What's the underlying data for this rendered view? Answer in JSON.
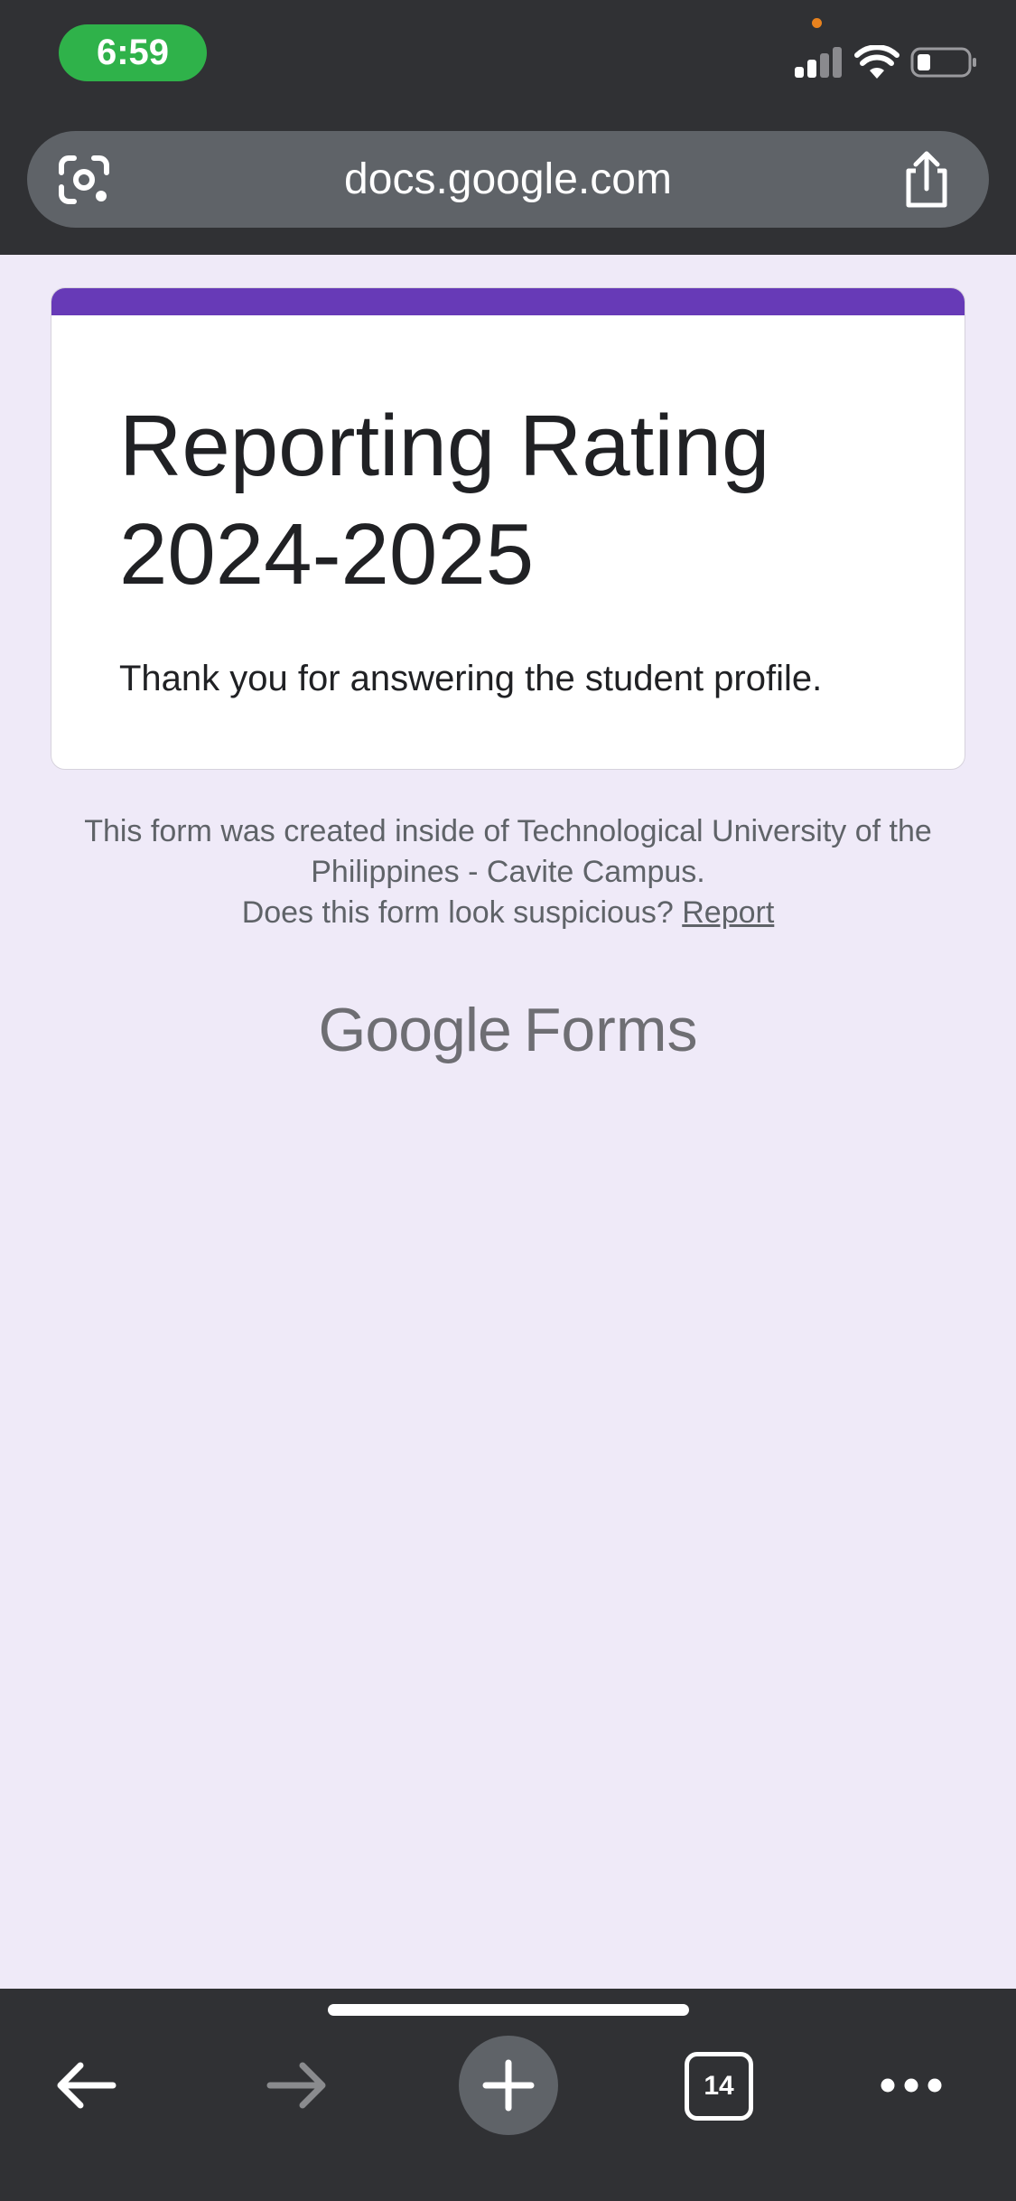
{
  "status_bar": {
    "time": "6:59"
  },
  "browser": {
    "url": "docs.google.com",
    "tab_count": "14"
  },
  "form": {
    "title": "Reporting Rating 2024-2025",
    "message": "Thank you for answering the student profile.",
    "accent_color": "#673ab7"
  },
  "footer": {
    "org_line": "This form was created inside of Technological University of the Philippines - Cavite Campus.",
    "suspicious_text": "Does this form look suspicious?",
    "report_label": "Report",
    "logo_google": "Google",
    "logo_forms": "Forms"
  },
  "icons": {
    "lens": "google-lens-icon",
    "share": "share-icon",
    "back": "back-arrow-icon",
    "forward": "forward-arrow-icon",
    "new_tab": "plus-icon",
    "tabs": "tab-switcher-icon",
    "menu": "more-horizontal-icon"
  }
}
